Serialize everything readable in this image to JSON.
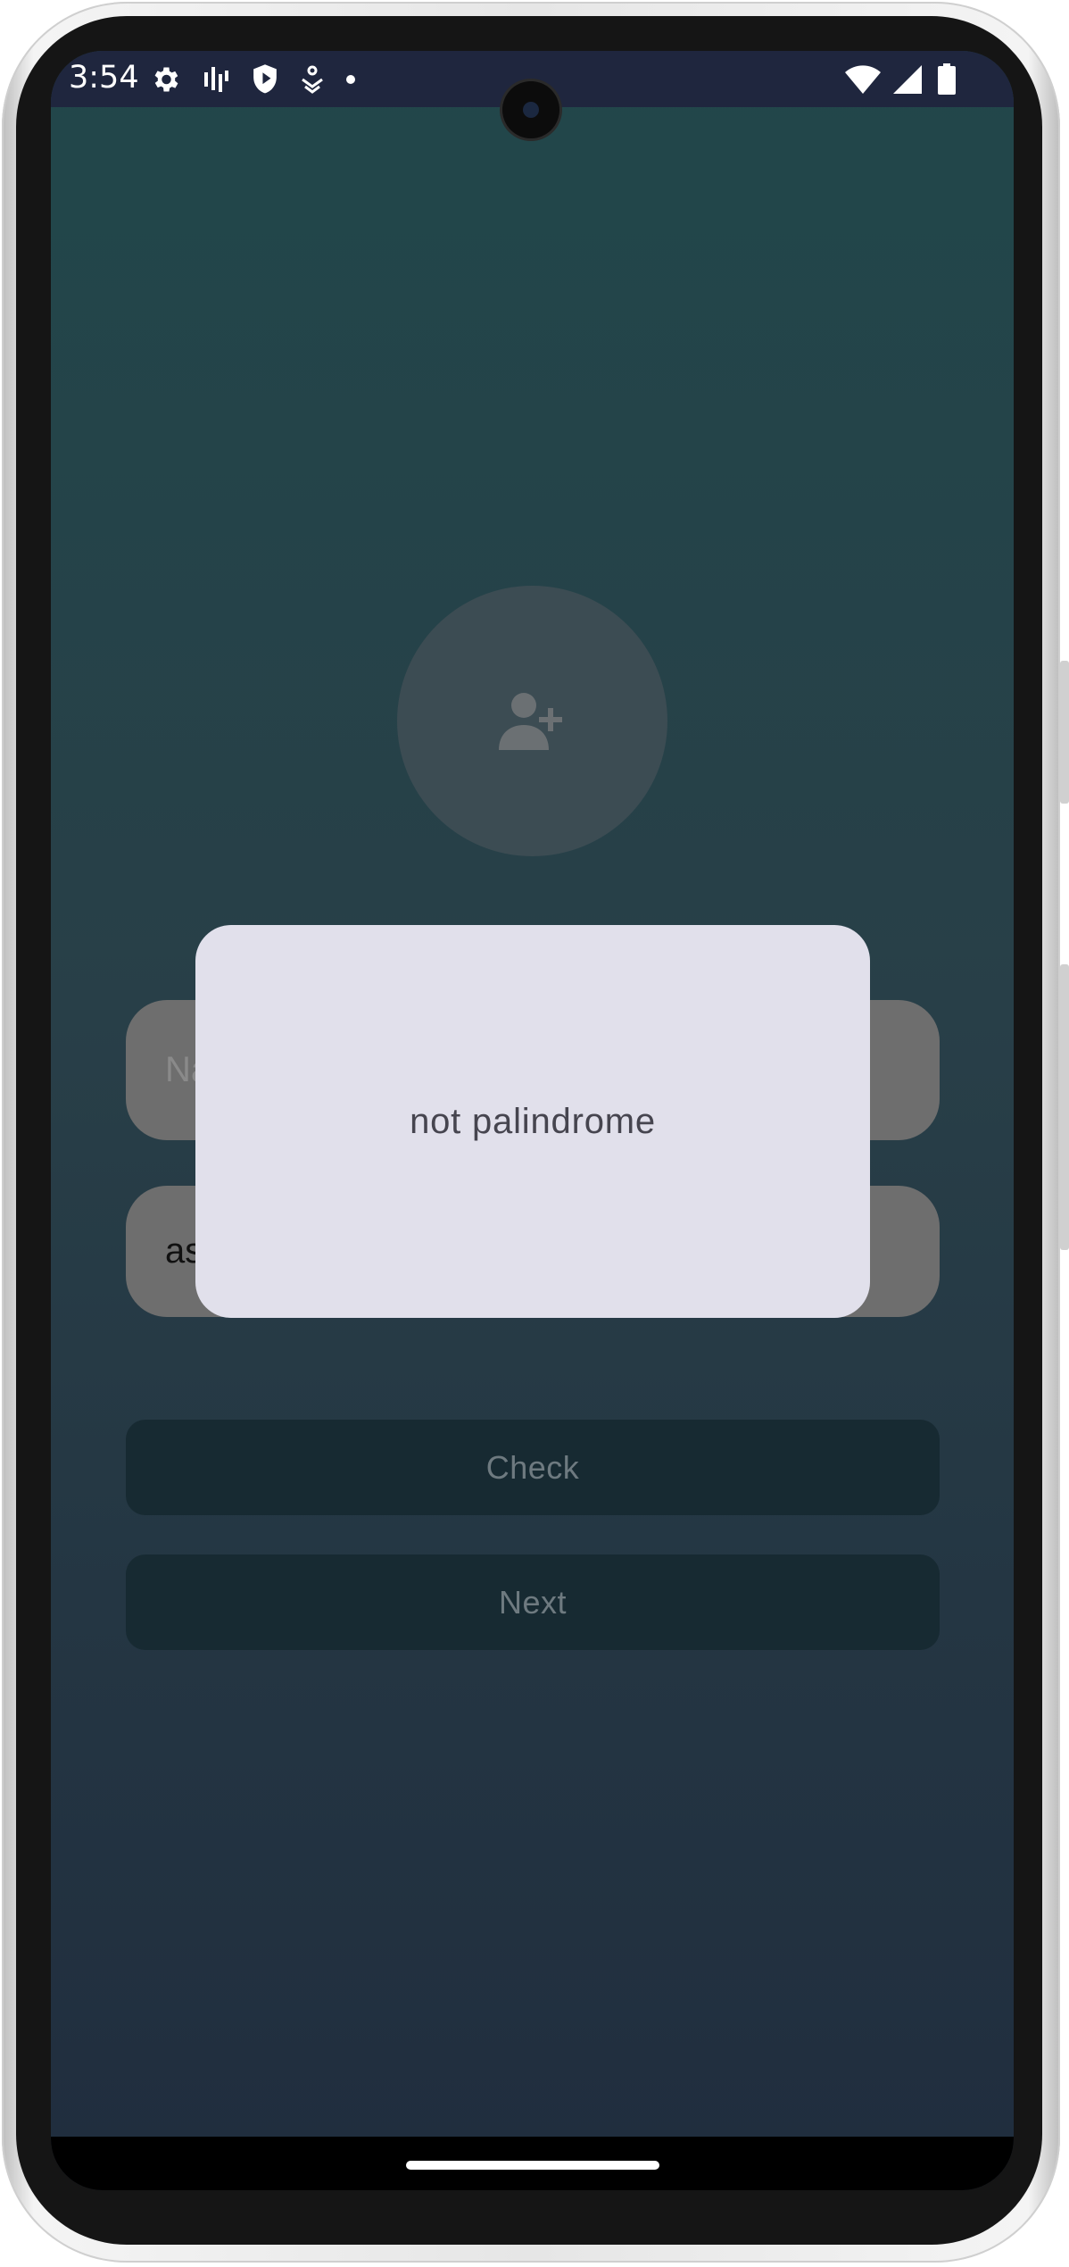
{
  "status_bar": {
    "time": "3:54",
    "left_icons": [
      "gear-icon",
      "audio-bars-icon",
      "shield-icon",
      "fitness-icon",
      "dot-icon"
    ],
    "right_icons": [
      "wifi-icon",
      "signal-icon",
      "battery-icon"
    ]
  },
  "app": {
    "avatar_icon": "add-person-icon",
    "name_field": {
      "placeholder": "Name",
      "value": ""
    },
    "sentence_field": {
      "value": "asdf"
    },
    "check_label": "Check",
    "next_label": "Next"
  },
  "dialog": {
    "message": "not palindrome"
  },
  "colors": {
    "background_top": "#21474a",
    "background_bottom": "#202d3e",
    "dialog": "#e1e0eb",
    "button": "#172a32",
    "field": "#6e6e6e"
  }
}
